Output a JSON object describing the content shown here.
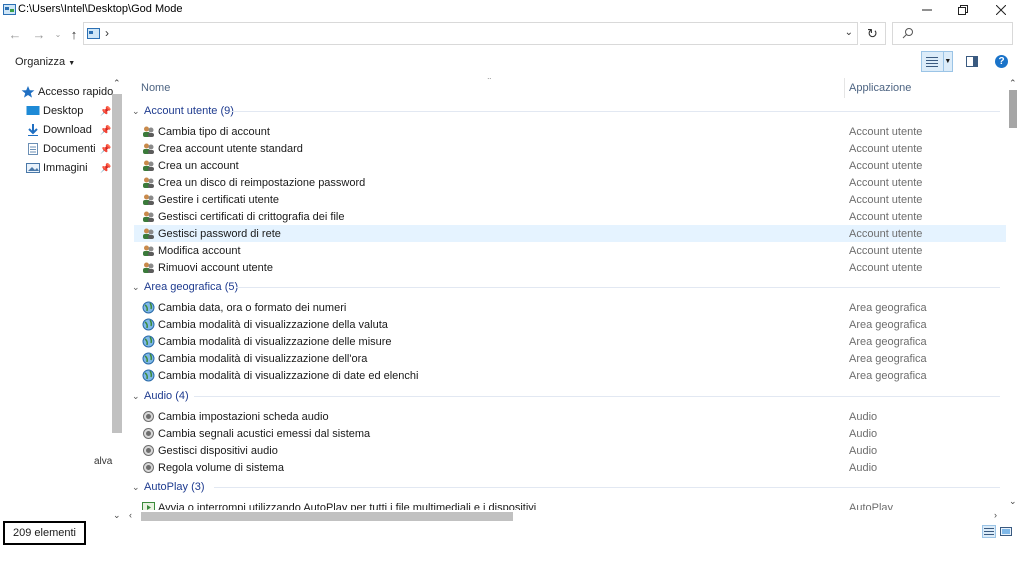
{
  "window": {
    "title": "C:\\Users\\Intel\\Desktop\\God Mode"
  },
  "address": {
    "separator": "›"
  },
  "search": {
    "placeholder": ""
  },
  "toolbar": {
    "organize_label": "Organizza"
  },
  "help_label": "?",
  "sidebar": {
    "items": [
      {
        "label": "Accesso rapido",
        "icon": "star-icon"
      },
      {
        "label": "Desktop",
        "icon": "desktop-icon",
        "pinned": true
      },
      {
        "label": "Download",
        "icon": "download-icon",
        "pinned": true
      },
      {
        "label": "Documenti",
        "icon": "documents-icon",
        "pinned": true
      },
      {
        "label": "Immagini",
        "icon": "pictures-icon",
        "pinned": true
      }
    ],
    "stray_text": "alva"
  },
  "columns": {
    "name": "Nome",
    "app": "Applicazione"
  },
  "groups": [
    {
      "label": "Account utente (9)",
      "icon": "users-icon",
      "rows": [
        {
          "name": "Cambia tipo di account",
          "app": "Account utente"
        },
        {
          "name": "Crea account utente standard",
          "app": "Account utente"
        },
        {
          "name": "Crea un account",
          "app": "Account utente"
        },
        {
          "name": "Crea un disco di reimpostazione password",
          "app": "Account utente"
        },
        {
          "name": "Gestire i certificati utente",
          "app": "Account utente"
        },
        {
          "name": "Gestisci certificati di crittografia dei file",
          "app": "Account utente"
        },
        {
          "name": "Gestisci password di rete",
          "app": "Account utente",
          "highlighted": true
        },
        {
          "name": "Modifica account",
          "app": "Account utente"
        },
        {
          "name": "Rimuovi account utente",
          "app": "Account utente"
        }
      ]
    },
    {
      "label": "Area geografica (5)",
      "icon": "globe-icon",
      "rows": [
        {
          "name": "Cambia data, ora o formato dei numeri",
          "app": "Area geografica"
        },
        {
          "name": "Cambia modalità di visualizzazione della valuta",
          "app": "Area geografica"
        },
        {
          "name": "Cambia modalità di visualizzazione delle misure",
          "app": "Area geografica"
        },
        {
          "name": "Cambia modalità di visualizzazione dell'ora",
          "app": "Area geografica"
        },
        {
          "name": "Cambia modalità di visualizzazione di date ed elenchi",
          "app": "Area geografica"
        }
      ]
    },
    {
      "label": "Audio (4)",
      "icon": "speaker-icon",
      "rows": [
        {
          "name": "Cambia impostazioni scheda audio",
          "app": "Audio"
        },
        {
          "name": "Cambia segnali acustici emessi dal sistema",
          "app": "Audio"
        },
        {
          "name": "Gestisci dispositivi audio",
          "app": "Audio"
        },
        {
          "name": "Regola volume di sistema",
          "app": "Audio"
        }
      ]
    },
    {
      "label": "AutoPlay (3)",
      "icon": "autoplay-icon",
      "rows": [
        {
          "name": "Avvia o interrompi utilizzando AutoPlay per tutti i file multimediali e i dispositivi",
          "app": "AutoPlay"
        }
      ]
    }
  ],
  "status": {
    "count": "209 elementi"
  }
}
